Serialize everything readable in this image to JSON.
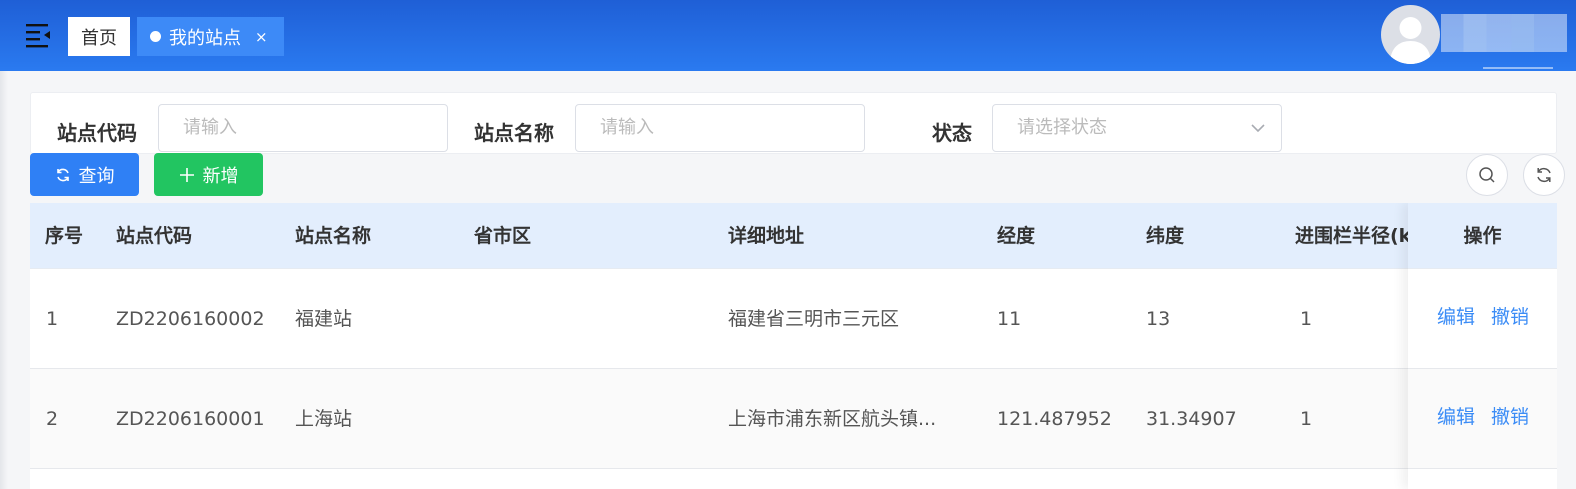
{
  "tabs": {
    "home": "首页",
    "active": "我的站点",
    "close": "×"
  },
  "filters": {
    "code_label": "站点代码",
    "code_placeholder": "请输入",
    "name_label": "站点名称",
    "name_placeholder": "请输入",
    "status_label": "状态",
    "status_placeholder": "请选择状态"
  },
  "buttons": {
    "query": "查询",
    "add": "新增"
  },
  "table": {
    "columns": [
      "序号",
      "站点代码",
      "站点名称",
      "省市区",
      "详细地址",
      "经度",
      "纬度",
      "进围栏半径(k",
      "操作"
    ],
    "rows": [
      {
        "index": "1",
        "code": "ZD2206160002",
        "name": "福建站",
        "region": "",
        "address": "福建省三明市三元区",
        "lng": "11",
        "lat": "13",
        "radius": "1"
      },
      {
        "index": "2",
        "code": "ZD2206160001",
        "name": "上海站",
        "region": "",
        "address": "上海市浦东新区航头镇...",
        "lng": "121.487952",
        "lat": "31.34907",
        "radius": "1"
      }
    ],
    "actions": {
      "edit": "编辑",
      "revoke": "撤销"
    }
  },
  "colors": {
    "header": "#2a7af0",
    "primary": "#2f80f5",
    "success": "#22c561",
    "link": "#3b8cf6",
    "table_header": "#e3eefd"
  },
  "icons": [
    "menu-fold-icon",
    "user-avatar-icon",
    "refresh-icon",
    "plus-icon",
    "search-icon",
    "reload-icon",
    "chevron-down-icon"
  ]
}
